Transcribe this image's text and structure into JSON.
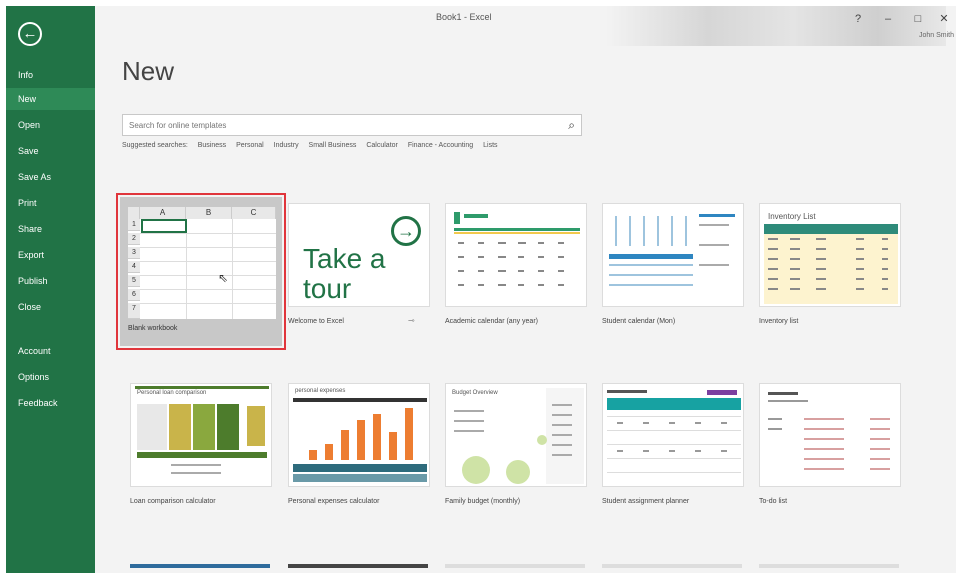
{
  "window": {
    "title": "Book1 - Excel",
    "user": "John Smith",
    "help_label": "?",
    "minimize_label": "–",
    "restore_label": "□",
    "close_label": "✕"
  },
  "sidebar": {
    "back_icon": "back-arrow-icon",
    "items": [
      {
        "label": "Info"
      },
      {
        "label": "New"
      },
      {
        "label": "Open"
      },
      {
        "label": "Save"
      },
      {
        "label": "Save As"
      },
      {
        "label": "Print"
      },
      {
        "label": "Share"
      },
      {
        "label": "Export"
      },
      {
        "label": "Publish"
      },
      {
        "label": "Close"
      },
      {
        "label": "Account"
      },
      {
        "label": "Options"
      },
      {
        "label": "Feedback"
      }
    ],
    "active": "New"
  },
  "main": {
    "title": "New",
    "search_placeholder": "Search for online templates",
    "suggested_label": "Suggested searches:",
    "suggested": [
      "Business",
      "Personal",
      "Industry",
      "Small Business",
      "Calculator",
      "Finance - Accounting",
      "Lists"
    ]
  },
  "blank": {
    "columns": [
      "A",
      "B",
      "C"
    ],
    "rows": [
      "1",
      "2",
      "3",
      "4",
      "5",
      "6",
      "7"
    ],
    "label": "Blank workbook"
  },
  "templates_row1": [
    {
      "label": "Welcome to Excel",
      "tour": "Take a tour"
    },
    {
      "label": "Academic calendar (any year)"
    },
    {
      "label": "Student calendar (Mon)"
    },
    {
      "label": "Inventory list",
      "title": "Inventory List"
    }
  ],
  "templates_row2": [
    {
      "label": "Loan comparison calculator",
      "title": "Personal loan comparison"
    },
    {
      "label": "Personal expenses calculator",
      "title": "personal expenses"
    },
    {
      "label": "Family budget (monthly)",
      "title": "Budget Overview"
    },
    {
      "label": "Student assignment planner"
    },
    {
      "label": "To-do list"
    }
  ],
  "colors": {
    "accent": "#217346",
    "selection": "#e0353b",
    "orange": "#ed7d31"
  }
}
